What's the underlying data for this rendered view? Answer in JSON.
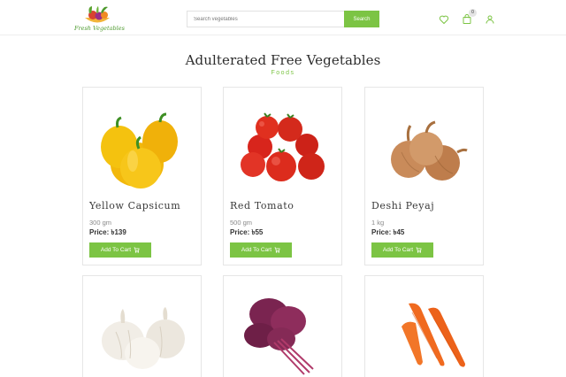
{
  "brand": {
    "name": "Fresh Vegetables"
  },
  "search": {
    "placeholder": "Search vegetables",
    "button_label": "Search"
  },
  "header": {
    "cart_count": "0"
  },
  "section": {
    "title": "Adulterated Free Vegetables",
    "subtitle": "Foods"
  },
  "products": [
    {
      "name": "Yellow Capsicum",
      "weight": "300 gm",
      "price": "Price: ৳139",
      "button": "Add To Cart",
      "image": "yellow-capsicum"
    },
    {
      "name": "Red Tomato",
      "weight": "500 gm",
      "price": "Price: ৳55",
      "button": "Add To Cart",
      "image": "red-tomato"
    },
    {
      "name": "Deshi Peyaj",
      "weight": "1 kg",
      "price": "Price: ৳45",
      "button": "Add To Cart",
      "image": "onion"
    },
    {
      "name": "",
      "weight": "",
      "price": "",
      "button": "",
      "image": "garlic"
    },
    {
      "name": "",
      "weight": "",
      "price": "",
      "button": "",
      "image": "red-amaranth"
    },
    {
      "name": "",
      "weight": "",
      "price": "",
      "button": "",
      "image": "carrot"
    }
  ],
  "colors": {
    "accent": "#7cc444",
    "text": "#333333",
    "border": "#e6e6e6"
  },
  "icons": [
    "heart-icon",
    "shopping-bag-icon",
    "user-icon",
    "cart-icon"
  ]
}
